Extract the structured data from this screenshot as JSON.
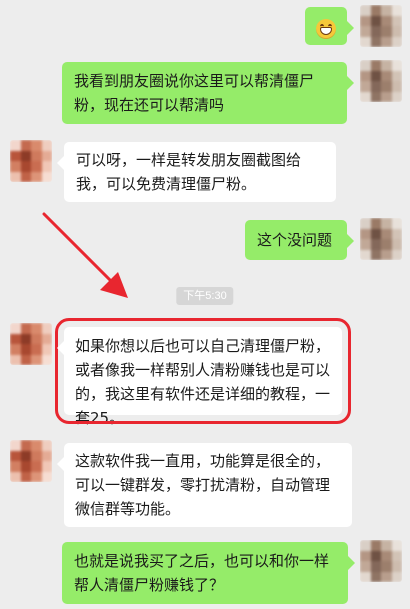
{
  "conversation": {
    "time_divider": "下午5:30",
    "messages": [
      {
        "sender": "self",
        "type": "emoji",
        "emoji": "grinning-face"
      },
      {
        "sender": "self",
        "type": "text",
        "text": "我看到朋友圈说你这里可以帮清僵尸粉，现在还可以帮清吗"
      },
      {
        "sender": "other",
        "type": "text",
        "text": "可以呀，一样是转发朋友圈截图给我，可以免费清理僵尸粉。"
      },
      {
        "sender": "self",
        "type": "text",
        "text": "这个没问题"
      },
      {
        "sender": "other",
        "type": "text",
        "text": "如果你想以后也可以自己清理僵尸粉，或者像我一样帮别人清粉赚钱也是可以的，我这里有软件还是详细的教程，一套25。"
      },
      {
        "sender": "other",
        "type": "text",
        "text": "这款软件我一直用，功能算是很全的，可以一键群发，零打扰清粉，自动管理微信群等功能。"
      },
      {
        "sender": "self",
        "type": "text",
        "text": "也就是说我买了之后，也可以和你一样帮人清僵尸粉赚钱了？"
      }
    ]
  },
  "colors": {
    "background": "#ededed",
    "self_bubble": "#95ec69",
    "other_bubble": "#ffffff",
    "highlight": "#e8262f"
  }
}
